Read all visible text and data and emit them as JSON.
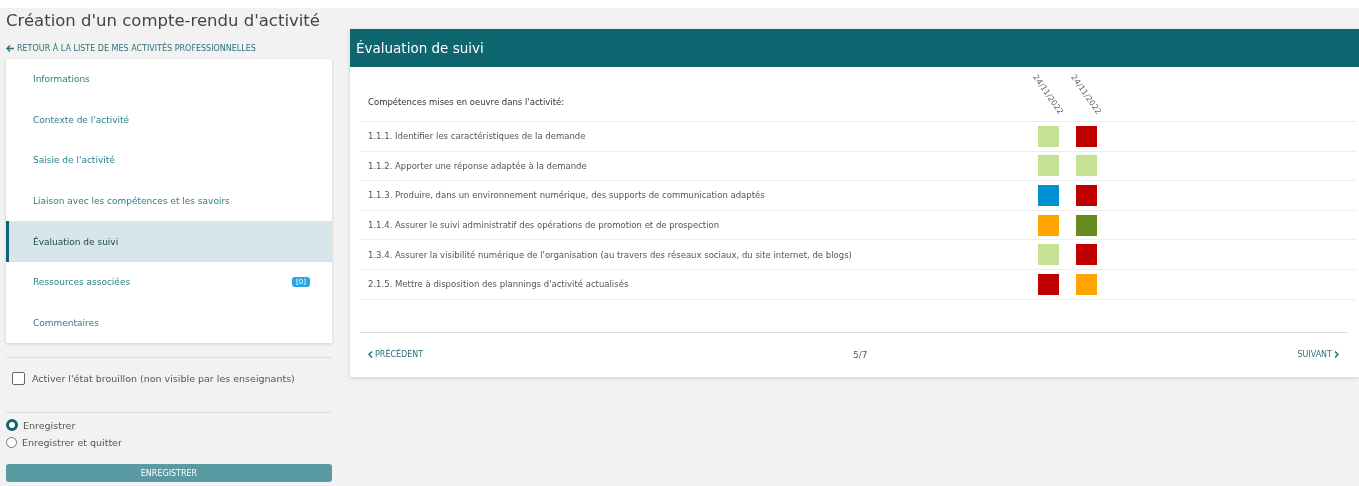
{
  "page_title": "Création d'un compte-rendu d'activité",
  "back_link": "RETOUR À LA LISTE DE MES ACTIVITÉS PROFESSIONNELLES",
  "sidebar": {
    "items": [
      {
        "label": "Informations",
        "selected": false
      },
      {
        "label": "Contexte de l'activité",
        "selected": false
      },
      {
        "label": "Saisie de l'activité",
        "selected": false
      },
      {
        "label": "Liaison avec les compétences et les savoirs",
        "selected": false
      },
      {
        "label": "Évaluation de suivi",
        "selected": true
      },
      {
        "label": "Ressources associées",
        "selected": false,
        "badge": "[0]"
      },
      {
        "label": "Commentaires",
        "selected": false
      }
    ]
  },
  "draft_checkbox": {
    "label": "Activer l'état brouillon (non visible par les enseignants)",
    "checked": false
  },
  "save_options": [
    {
      "label": "Enregistrer",
      "selected": true
    },
    {
      "label": "Enregistrer et quitter",
      "selected": false
    }
  ],
  "save_button": "ENREGISTRER",
  "panel": {
    "title": "Évaluation de suivi",
    "heading": "Compétences mises en oeuvre dans l'activité:",
    "dates": [
      "24/11/2022",
      "24/11/2022"
    ],
    "rows": [
      {
        "label": "1.1.1. Identifier les caractéristiques de la demande",
        "cells": [
          {
            "color": "#c5e294"
          },
          {
            "color": "#c00000"
          }
        ]
      },
      {
        "label": "1.1.2. Apporter une réponse adaptée à la demande",
        "cells": [
          {
            "color": "#c5e294"
          },
          {
            "color": "#c5e294"
          }
        ]
      },
      {
        "label": "1.1.3. Produire, dans un environnement numérique, des supports de communication adaptés",
        "cells": [
          {
            "color": "#0090d4"
          },
          {
            "color": "#c00000"
          }
        ]
      },
      {
        "label": "1.1.4. Assurer le suivi administratif des opérations de promotion et de prospection",
        "cells": [
          {
            "color": "#ffa500"
          },
          {
            "color": "#668c1f"
          }
        ]
      },
      {
        "label": "1.3.4. Assurer la visibilité numérique de l'organisation (au travers des réseaux sociaux, du site internet, de blogs)",
        "cells": [
          {
            "color": "#c5e294"
          },
          {
            "color": "#c00000"
          }
        ]
      },
      {
        "label": "2.1.5. Mettre à disposition des plannings d'activité actualisés",
        "cells": [
          {
            "color": "#c00000"
          },
          {
            "color": "#ffa500"
          }
        ]
      }
    ],
    "prev": "PRÉCÉDENT",
    "page": "5/7",
    "next": "SUIVANT"
  }
}
